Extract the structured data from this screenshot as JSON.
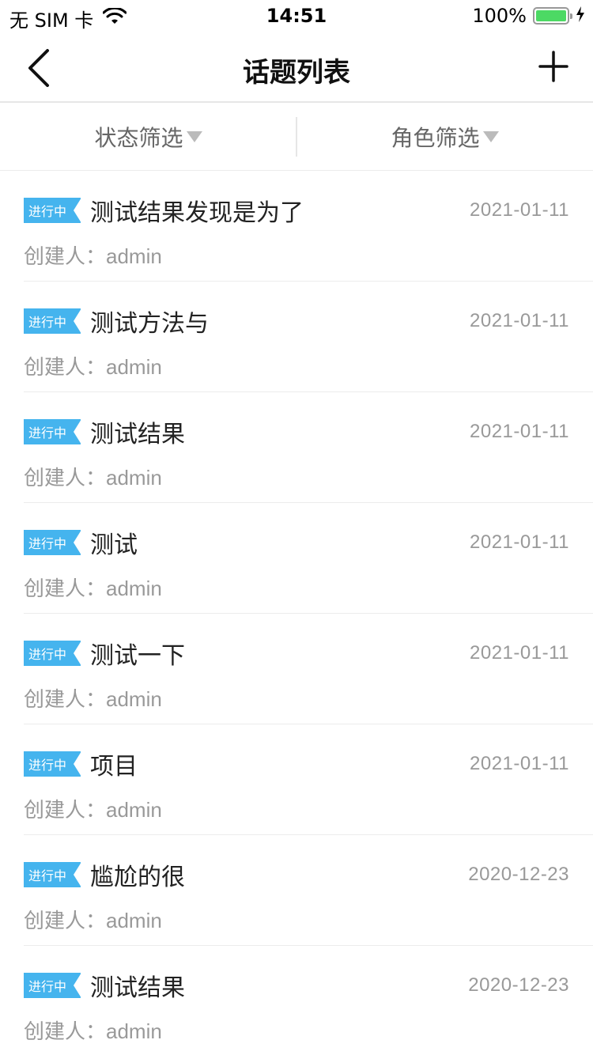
{
  "status_bar": {
    "carrier": "无 SIM 卡",
    "time": "14:51",
    "battery_percent": "100%",
    "battery_level": 1.0,
    "battery_color": "#4cd964"
  },
  "nav": {
    "title": "话题列表",
    "back_icon": "chevron-left-icon",
    "add_icon": "plus-icon"
  },
  "filters": {
    "status_label": "状态筛选",
    "role_label": "角色筛选"
  },
  "accent_color": "#45b4ee",
  "topics": [
    {
      "badge": "进行中",
      "title": "测试结果发现是为了",
      "date": "2021-01-11",
      "creator_label": "创建人：",
      "creator": "admin"
    },
    {
      "badge": "进行中",
      "title": "测试方法与",
      "date": "2021-01-11",
      "creator_label": "创建人：",
      "creator": "admin"
    },
    {
      "badge": "进行中",
      "title": "测试结果",
      "date": "2021-01-11",
      "creator_label": "创建人：",
      "creator": "admin"
    },
    {
      "badge": "进行中",
      "title": "测试",
      "date": "2021-01-11",
      "creator_label": "创建人：",
      "creator": "admin"
    },
    {
      "badge": "进行中",
      "title": "测试一下",
      "date": "2021-01-11",
      "creator_label": "创建人：",
      "creator": "admin"
    },
    {
      "badge": "进行中",
      "title": "项目",
      "date": "2021-01-11",
      "creator_label": "创建人：",
      "creator": "admin"
    },
    {
      "badge": "进行中",
      "title": "尴尬的很",
      "date": "2020-12-23",
      "creator_label": "创建人：",
      "creator": "admin"
    },
    {
      "badge": "进行中",
      "title": "测试结果",
      "date": "2020-12-23",
      "creator_label": "创建人：",
      "creator": "admin"
    }
  ]
}
